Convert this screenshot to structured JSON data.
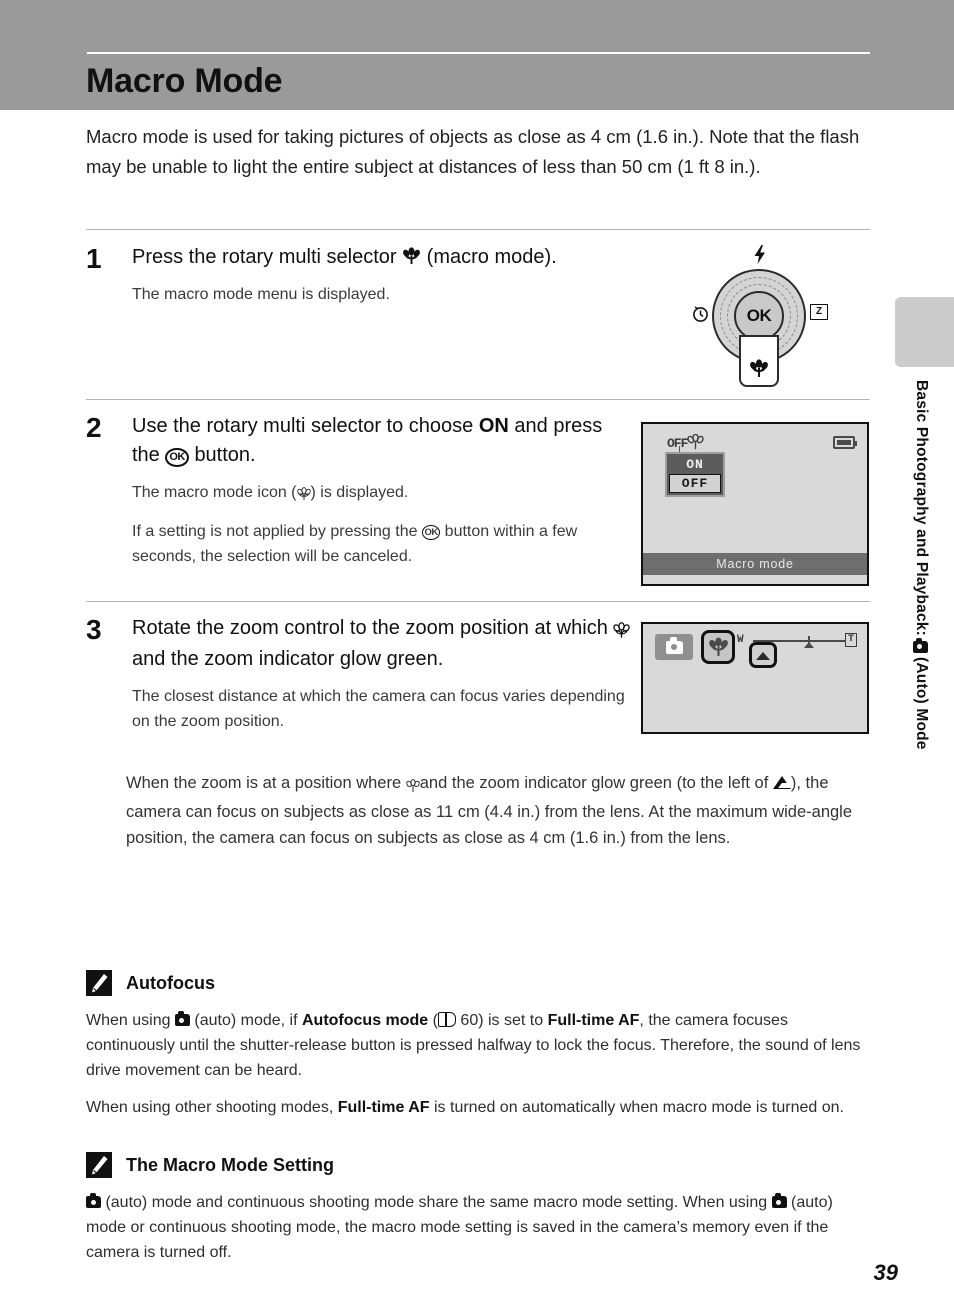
{
  "header": {
    "title": "Macro Mode"
  },
  "intro": "Macro mode is used for taking pictures of objects as close as 4 cm (1.6 in.). Note that the flash may be unable to light the entire subject at distances of less than 50 cm (1 ft 8 in.).",
  "steps": [
    {
      "number": "1",
      "head_before": "Press the rotary multi selector",
      "head_icon": "macro-flower-icon",
      "head_after": "(macro mode).",
      "sub1": "The macro mode menu is displayed."
    },
    {
      "number": "2",
      "head_before": "Use the rotary multi selector to choose",
      "head_bold": "ON",
      "head_mid": "and press the",
      "head_icon": "ok-button-icon",
      "head_after": "button.",
      "sub1_before": "The macro mode icon (",
      "sub1_after": ") is displayed.",
      "sub2_before": "If a setting is not applied by pressing the",
      "sub2_after": "button within a few seconds, the selection will be canceled."
    },
    {
      "number": "3",
      "head_before": "Rotate the zoom control to the zoom position at which",
      "head_after": "and the zoom indicator glow green.",
      "sub1": "The closest distance at which the camera can focus varies depending on the zoom position."
    }
  ],
  "step3_note": {
    "part1": "When the zoom is at a position where",
    "part2": "and the zoom indicator glow green (to the left of",
    "part3": "), the camera can focus on subjects as close as 11 cm (4.4 in.) from the lens. At the maximum wide-angle position, the camera can focus on subjects as close as 4 cm (1.6 in.) from the lens."
  },
  "rotary": {
    "ok_label": "OK",
    "flash_icon": "flash-icon",
    "timer_icon": "self-timer-icon",
    "exposure_label": "Z",
    "macro_icon": "macro-flower-icon"
  },
  "lcd_step2": {
    "status_icon_text": "OFF",
    "menu_options": [
      "ON",
      "OFF"
    ],
    "selected_option": "OFF",
    "bottom_label": "Macro mode",
    "battery_icon": "battery-icon"
  },
  "lcd_step3": {
    "mode_icon": "auto-camera-icon",
    "macro_icon": "macro-flower-icon",
    "zoom_wide_label": "W",
    "zoom_tele_label": "T",
    "zoom_indicator_icon": "zoom-triangle-icon",
    "zoom_mid_icon": "landscape-mark-icon"
  },
  "side_tab": {
    "label": "Basic Photography and Playback:",
    "label_tail": "(Auto) Mode"
  },
  "notes": [
    {
      "icon": "pencil-note-icon",
      "title": "Autofocus",
      "paragraphs": [
        {
          "segments": [
            {
              "t": "When using ",
              "b": false
            },
            {
              "t": "ICON_CAMERA",
              "b": false
            },
            {
              "t": " (auto) mode, if ",
              "b": false
            },
            {
              "t": "Autofocus mode",
              "b": true
            },
            {
              "t": " (",
              "b": false
            },
            {
              "t": "ICON_BOOK",
              "b": false
            },
            {
              "t": " 60) is set to ",
              "b": false
            },
            {
              "t": "Full-time AF",
              "b": true
            },
            {
              "t": ", the camera focuses continuously until the shutter-release button is pressed halfway to lock the focus. Therefore, the sound of lens drive movement can be heard.",
              "b": false
            }
          ]
        },
        {
          "segments": [
            {
              "t": "When using other shooting modes, ",
              "b": false
            },
            {
              "t": "Full-time AF",
              "b": true
            },
            {
              "t": " is turned on automatically when macro mode is turned on.",
              "b": false
            }
          ]
        }
      ]
    },
    {
      "icon": "pencil-note-icon",
      "title": "The Macro Mode Setting",
      "paragraphs": [
        {
          "segments": [
            {
              "t": "ICON_CAMERA",
              "b": false
            },
            {
              "t": " (auto) mode and continuous shooting mode share the same macro mode setting. When using ",
              "b": false
            },
            {
              "t": "ICON_CAMERA",
              "b": false
            },
            {
              "t": " (auto) mode or continuous shooting mode, the macro mode setting is saved in the camera’s memory even if the camera is turned off.",
              "b": false
            }
          ]
        }
      ]
    }
  ],
  "page_number": "39",
  "colors": {
    "header_band": "#9a9a9a",
    "lcd_background": "#d9d9d9",
    "lcd_bar": "#6e6e6e",
    "side_tab": "#cccccc",
    "rule": "#b4b4b4"
  }
}
